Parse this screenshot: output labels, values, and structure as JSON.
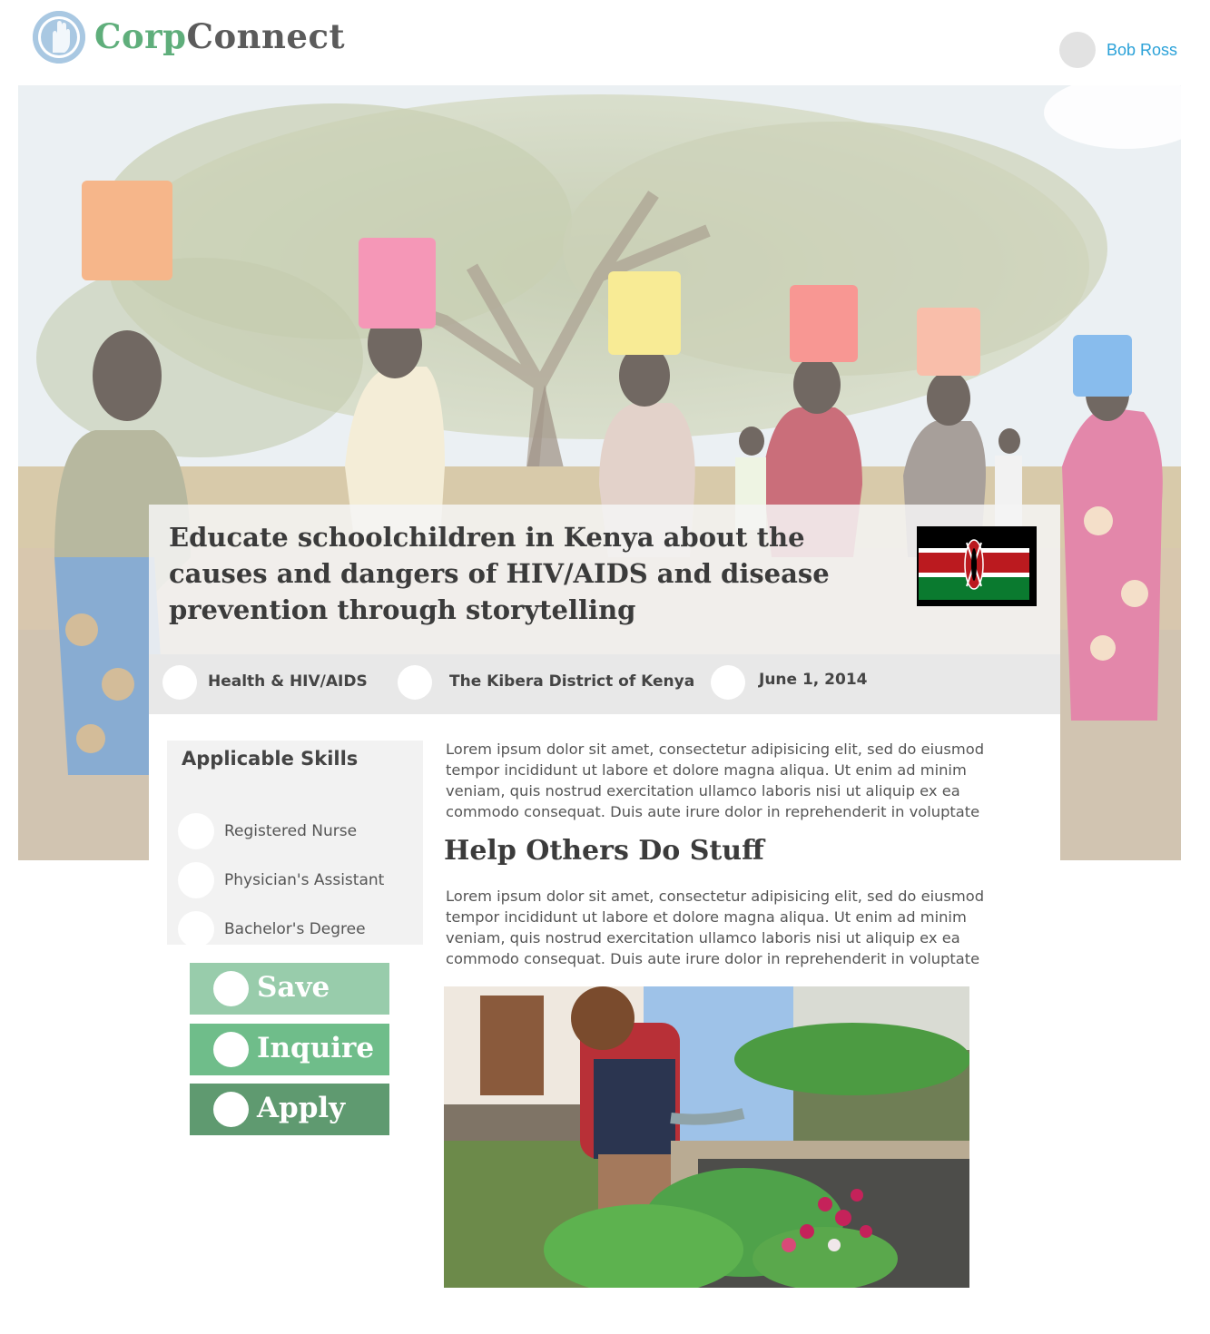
{
  "brand": {
    "name_part1": "Corp",
    "name_part2": "Connect",
    "logo_icon": "raised-hand-icon",
    "color_primary": "#5fae7b",
    "color_secondary": "#5b5b5b"
  },
  "user": {
    "name": "Bob Ross",
    "link_color": "#2aa1d8"
  },
  "opportunity": {
    "title": "Educate schoolchildren in Kenya about the causes and dangers of HIV/AIDS and disease prevention through storytelling",
    "country_flag": "kenya-flag-icon",
    "meta": {
      "category": "Health & HIV/AIDS",
      "location": "The Kibera District of Kenya",
      "date": "June 1, 2014"
    }
  },
  "skills": {
    "heading": "Applicable Skills",
    "items": [
      {
        "label": "Registered Nurse"
      },
      {
        "label": "Physician's Assistant"
      },
      {
        "label": "Bachelor's Degree"
      }
    ]
  },
  "actions": {
    "save": {
      "label": "Save",
      "color": "#98ccab"
    },
    "inquire": {
      "label": "Inquire",
      "color": "#6fbd8a"
    },
    "apply": {
      "label": "Apply",
      "color": "#5f9a70"
    }
  },
  "content": {
    "paragraph1": "Lorem ipsum dolor sit amet, consectetur adipisicing elit, sed do eiusmod tempor incididunt ut labore et dolore magna aliqua. Ut enim ad minim veniam, quis nostrud exercitation ullamco laboris nisi ut aliquip ex ea commodo consequat. Duis aute irure dolor in reprehenderit in voluptate",
    "subheading": "Help Others Do Stuff",
    "paragraph2": "Lorem ipsum dolor sit amet, consectetur adipisicing elit, sed do eiusmod tempor incididunt ut labore et dolore magna aliqua. Ut enim ad minim veniam, quis nostrud exercitation ullamco laboris nisi ut aliquip ex ea commodo consequat. Duis aute irure dolor in reprehenderit in voluptate"
  }
}
